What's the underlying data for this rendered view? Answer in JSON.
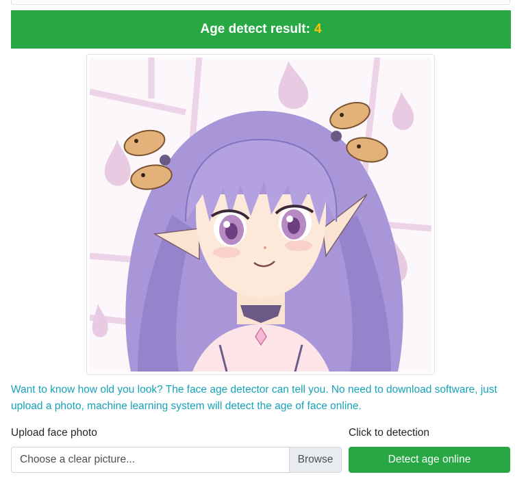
{
  "result": {
    "label": "Age detect result:",
    "value": "4"
  },
  "intro_text": "Want to know how old you look? The face age detector can tell you. No need to download software, just upload a photo, machine learning system will detect the age of face online.",
  "upload": {
    "label": "Upload face photo",
    "placeholder": "Choose a clear picture...",
    "browse_label": "Browse"
  },
  "detect": {
    "label": "Click to detection",
    "button_label": "Detect age online"
  },
  "colors": {
    "banner": "#28a745",
    "result_value": "#ffc107",
    "intro_text": "#17a2b8",
    "detect_button": "#28a745"
  },
  "image": {
    "subject": "anime-girl-portrait"
  }
}
